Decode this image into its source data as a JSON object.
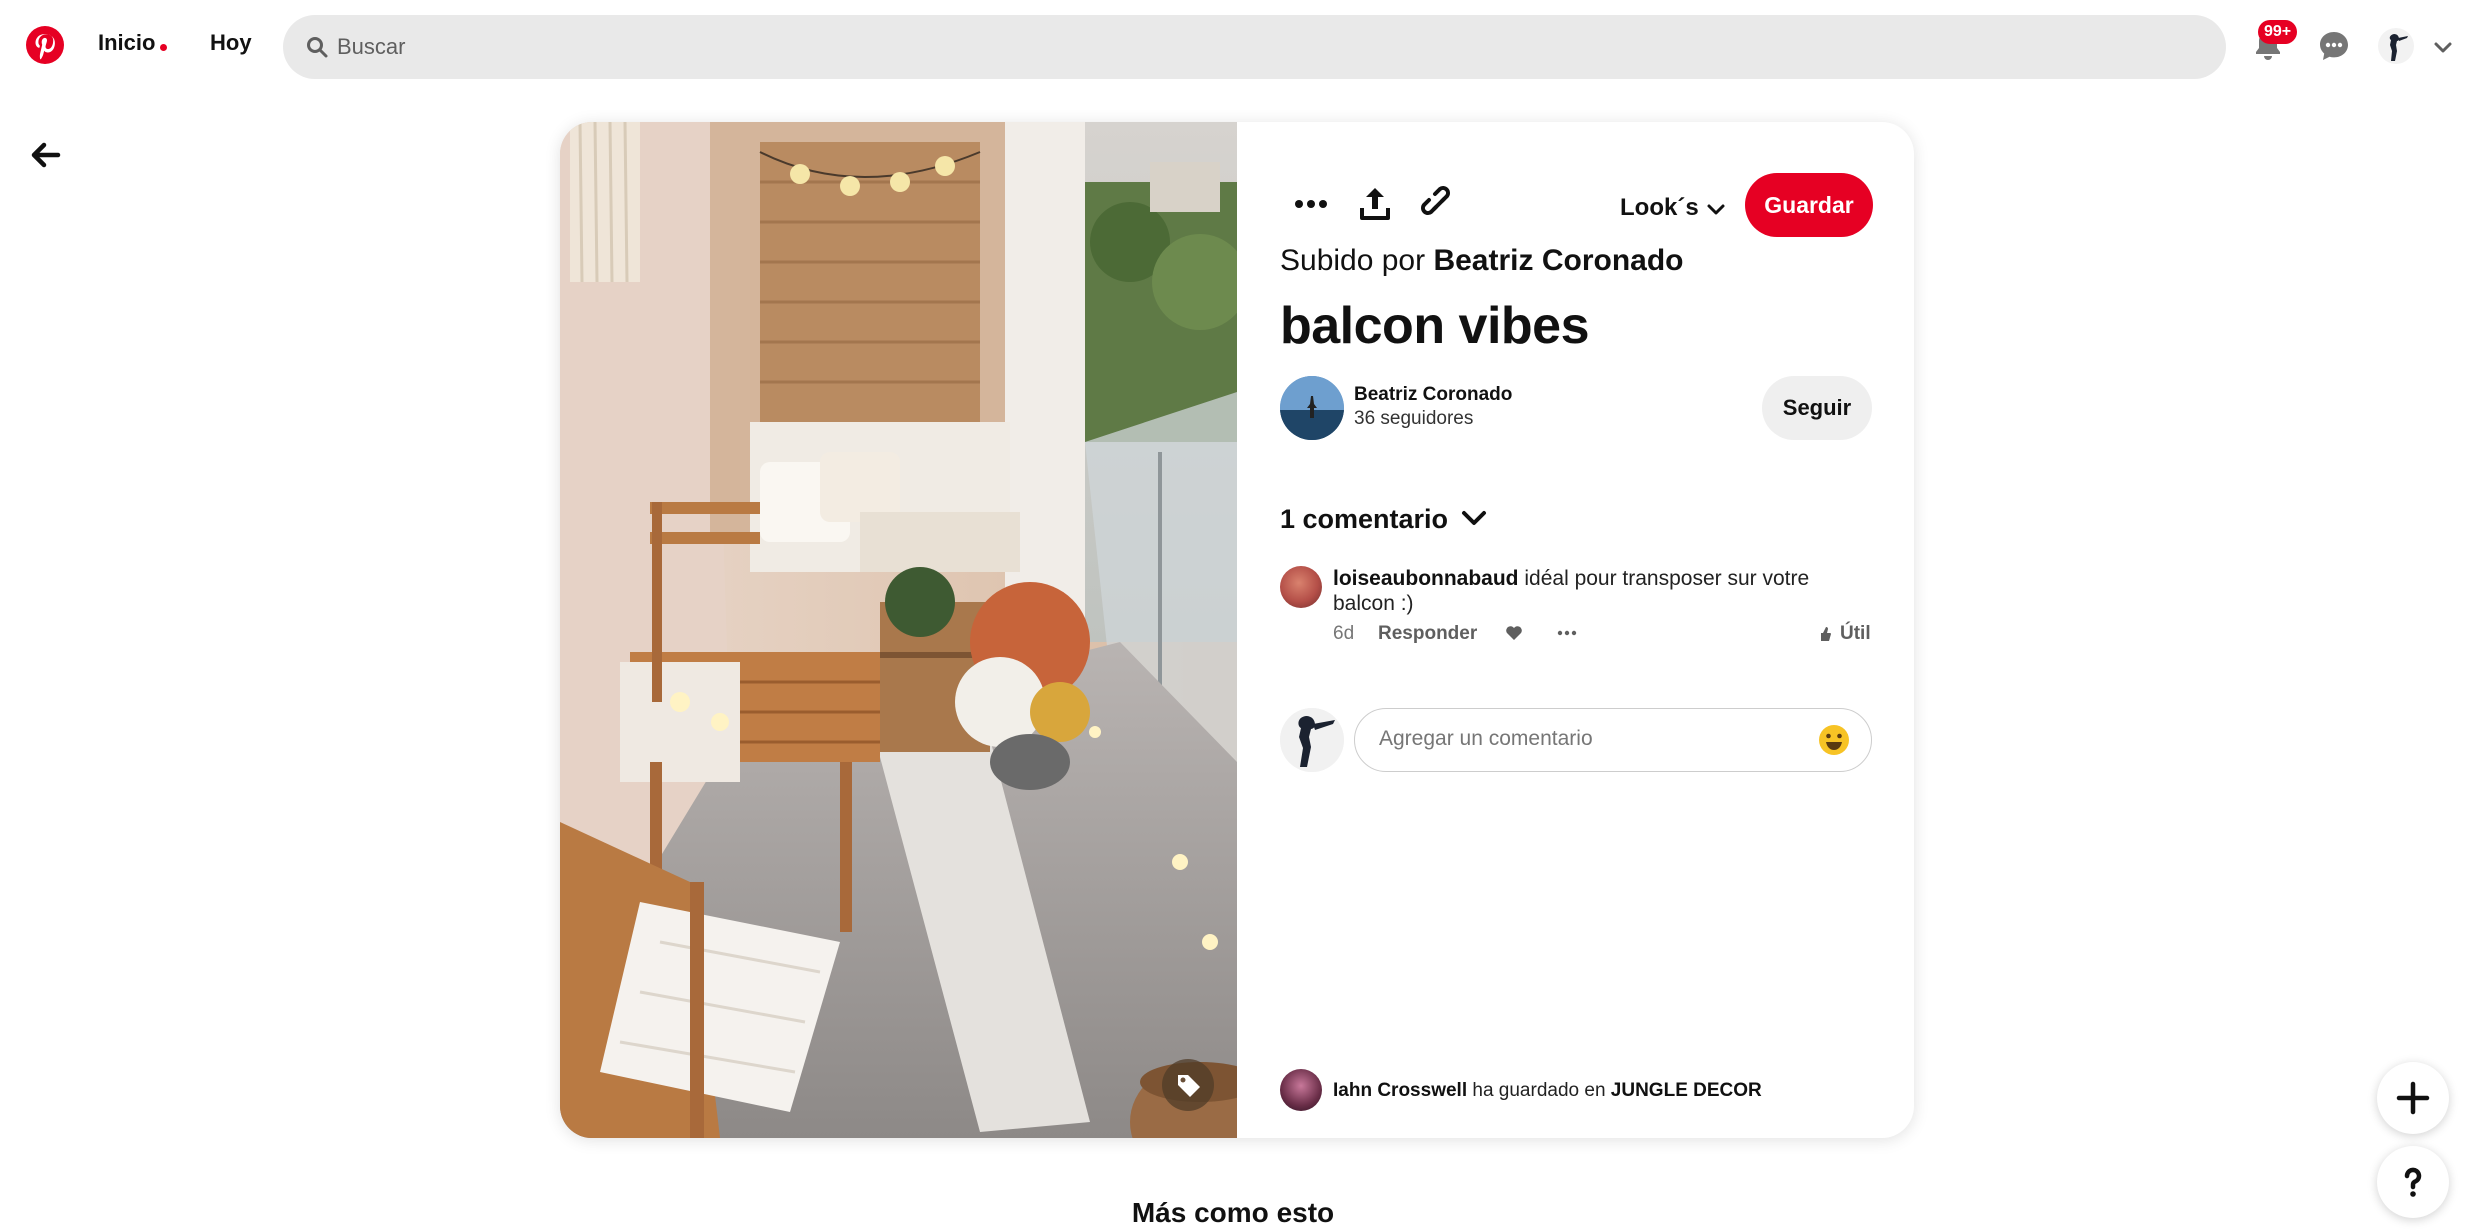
{
  "header": {
    "nav_home": "Inicio",
    "nav_today": "Hoy",
    "search_placeholder": "Buscar",
    "notifications_badge": "99+"
  },
  "pin": {
    "board_select": "Look´s",
    "save_label": "Guardar",
    "uploaded_prefix": "Subido por",
    "uploaded_by": "Beatriz Coronado",
    "title": "balcon vibes",
    "author": {
      "name": "Beatriz Coronado",
      "followers": "36 seguidores",
      "follow_label": "Seguir"
    },
    "comments": {
      "header": "1 comentario",
      "items": [
        {
          "user": "loiseaubonnabaud",
          "text": "idéal pour transposer sur votre balcon :)",
          "age": "6d",
          "reply_label": "Responder",
          "useful_label": "Útil"
        }
      ],
      "add_placeholder": "Agregar un comentario"
    },
    "saved_by": {
      "user": "Iahn Crosswell",
      "middle": "ha guardado en",
      "board": "JUNGLE DECOR"
    }
  },
  "more_like_this": "Más como esto",
  "colors": {
    "brand": "#e60023",
    "search_bg": "#e9e9e9",
    "follow_bg": "#efefef"
  },
  "icons": [
    "pinterest-logo-icon",
    "search-icon",
    "bell-icon",
    "chat-icon",
    "chevron-down-icon",
    "back-arrow-icon",
    "more-icon",
    "share-icon",
    "link-icon",
    "tag-icon",
    "heart-icon",
    "thumb-icon",
    "emoji-icon",
    "plus-icon",
    "help-icon"
  ]
}
